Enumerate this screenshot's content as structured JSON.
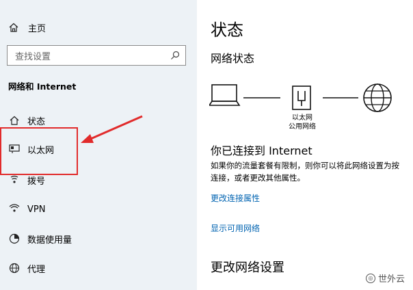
{
  "sidebar": {
    "home_label": "主页",
    "search_placeholder": "查找设置",
    "section_title": "网络和 Internet",
    "items": [
      {
        "label": "状态",
        "icon": "home-status-icon"
      },
      {
        "label": "以太网",
        "icon": "ethernet-icon"
      },
      {
        "label": "拨号",
        "icon": "dialup-icon"
      },
      {
        "label": "VPN",
        "icon": "vpn-icon"
      },
      {
        "label": "数据使用量",
        "icon": "data-usage-icon"
      },
      {
        "label": "代理",
        "icon": "globe-icon"
      }
    ]
  },
  "main": {
    "title": "状态",
    "subtitle": "网络状态",
    "adapter_name": "以太网",
    "adapter_network": "公用网络",
    "connected_text": "你已连接到 Internet",
    "description_line1": "如果你的流量套餐有限制，则你可以将此网络设置为按",
    "description_line2": "连接，或者更改其他属性。",
    "link_change_properties": "更改连接属性",
    "link_show_networks": "显示可用网络",
    "section_heading": "更改网络设置"
  },
  "watermark": "世外云",
  "annotation_color": "#e12b2b",
  "link_color": "#0063b1"
}
